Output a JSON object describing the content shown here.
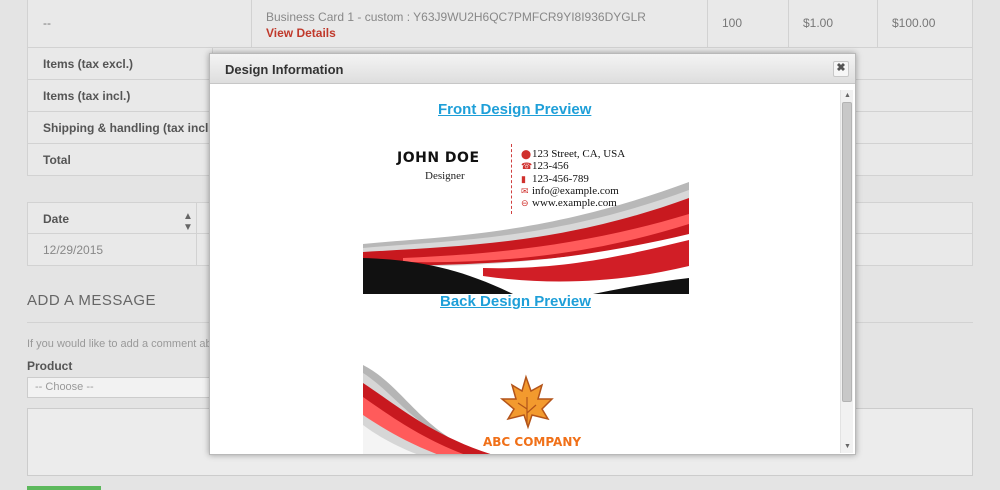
{
  "order_row": {
    "reference": "--",
    "product": "Business Card 1 - custom : Y63J9WU2H6QC7PMFCR9YI8I936DYGLR",
    "view_details": "View Details",
    "quantity": "100",
    "unit_price": "$1.00",
    "total": "$100.00"
  },
  "totals": [
    {
      "label": "Items (tax excl.)"
    },
    {
      "label": "Items (tax incl.)"
    },
    {
      "label": "Shipping & handling (tax incl.)"
    },
    {
      "label": "Total"
    }
  ],
  "date_table": {
    "header": "Date",
    "sort_icon": "sort-icon",
    "rows": [
      "12/29/2015"
    ]
  },
  "message": {
    "title": "ADD A MESSAGE",
    "hint": "If you would like to add a comment abo",
    "product_label": "Product",
    "product_select": "-- Choose --"
  },
  "modal": {
    "title": "Design Information",
    "close_icon": "close-icon",
    "front_link": "Front Design Preview",
    "back_link": "Back Design Preview"
  },
  "front_card": {
    "name": "JOHN DOE",
    "role": "Designer",
    "contacts": [
      {
        "icon": "map-pin-icon",
        "glyph": "⬤",
        "text": "123 Street, CA, USA"
      },
      {
        "icon": "phone-icon",
        "glyph": "☎",
        "text": "123-456"
      },
      {
        "icon": "mobile-icon",
        "glyph": "▮",
        "text": "123-456-789"
      },
      {
        "icon": "email-icon",
        "glyph": "✉",
        "text": "info@example.com"
      },
      {
        "icon": "web-icon",
        "glyph": "⊖",
        "text": "www.example.com"
      }
    ]
  },
  "back_card": {
    "company": "ABC COMPANY",
    "logo_icon": "maple-leaf-icon"
  },
  "colors": {
    "accent_red": "#d0312d",
    "link_blue": "#1e9fd8",
    "company_orange": "#f07018"
  }
}
